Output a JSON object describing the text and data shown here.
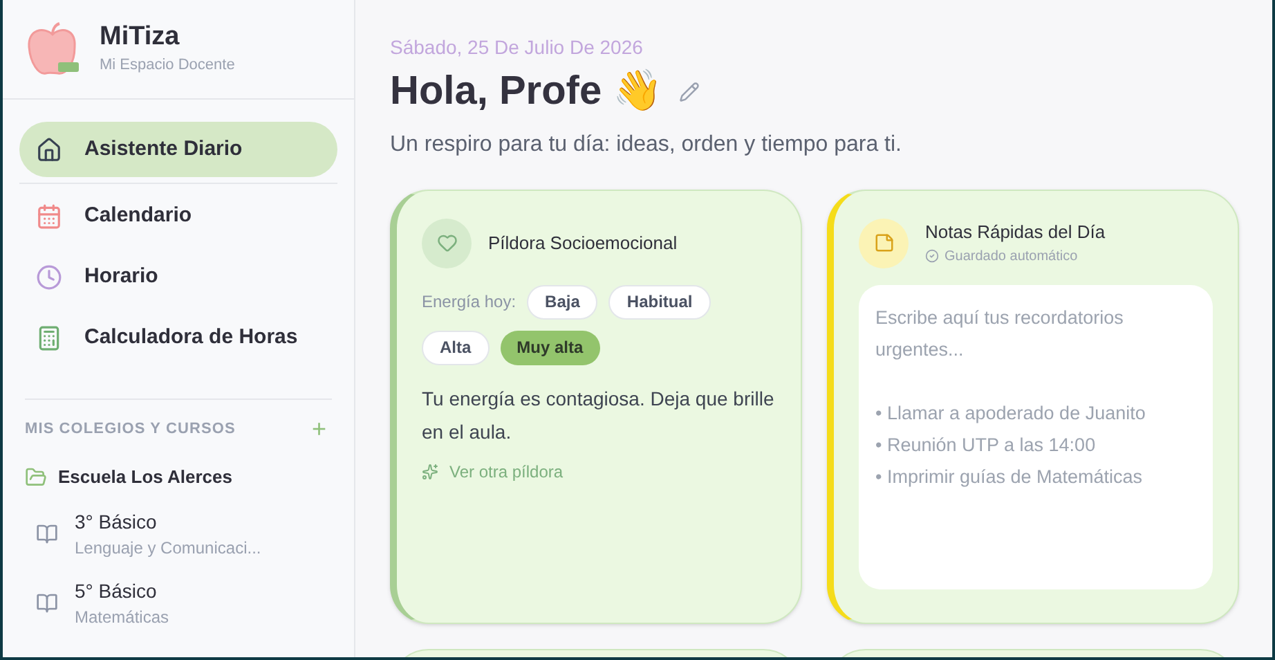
{
  "brand": {
    "name": "MiTiza",
    "tagline": "Mi Espacio Docente"
  },
  "nav": [
    {
      "label": "Asistente Diario",
      "selected": true
    },
    {
      "label": "Calendario",
      "selected": false
    },
    {
      "label": "Horario",
      "selected": false
    },
    {
      "label": "Calculadora de Horas",
      "selected": false
    }
  ],
  "schools_section": {
    "title": "MIS COLEGIOS Y CURSOS",
    "add": "+",
    "schools": [
      {
        "name": "Escuela Los Alerces",
        "courses": [
          {
            "name": "3° Básico",
            "subject": "Lenguaje y Comunicaci..."
          },
          {
            "name": "5° Básico",
            "subject": "Matemáticas"
          }
        ]
      }
    ]
  },
  "header": {
    "date": "Sábado, 25 De Julio De 2026",
    "greeting": "Hola, Profe 👋",
    "subtitle": "Un respiro para tu día: ideas, orden y tiempo para ti."
  },
  "pill_card": {
    "title": "Píldora Socioemocional",
    "energy_label": "Energía hoy:",
    "levels": [
      {
        "label": "Baja",
        "selected": false
      },
      {
        "label": "Habitual",
        "selected": false
      },
      {
        "label": "Alta",
        "selected": false
      },
      {
        "label": "Muy alta",
        "selected": true
      }
    ],
    "message": "Tu energía es contagiosa. Deja que brille en el aula.",
    "link": "Ver otra píldora"
  },
  "notes_card": {
    "title": "Notas Rápidas del Día",
    "status": "Guardado automático",
    "placeholder": "Escribe aquí tus recordatorios urgentes...\n\n• Llamar a apoderado de Juanito\n• Reunión UTP a las 14:00\n• Imprimir guías de Matemáticas"
  }
}
